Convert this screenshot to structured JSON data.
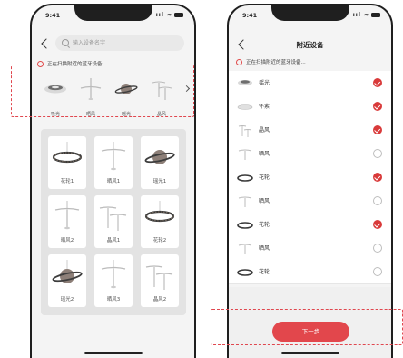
{
  "left_phone": {
    "status": {
      "time": "9:41",
      "indicators": "ııl ≈"
    },
    "search": {
      "placeholder": "输入设备名字"
    },
    "scan_text": "正在扫描附近的蓝牙设备...",
    "strip": [
      {
        "label": "吸光",
        "icon": "ceiling-light-icon"
      },
      {
        "label": "晒风",
        "icon": "fan-light-icon"
      },
      {
        "label": "瑶光",
        "icon": "planet-lamp-icon"
      },
      {
        "label": "晶风",
        "icon": "twin-fan-icon"
      }
    ],
    "grid": [
      {
        "label": "花轮1",
        "icon": "ring-chandelier-icon"
      },
      {
        "label": "晒风1",
        "icon": "fan-light-icon"
      },
      {
        "label": "瑶光1",
        "icon": "planet-lamp-icon"
      },
      {
        "label": "晒风2",
        "icon": "fan-light-icon"
      },
      {
        "label": "晶风1",
        "icon": "twin-fan-icon"
      },
      {
        "label": "花轮2",
        "icon": "ring-chandelier-icon"
      },
      {
        "label": "瑶光2",
        "icon": "planet-lamp-icon"
      },
      {
        "label": "晒风3",
        "icon": "fan-light-icon"
      },
      {
        "label": "晶风2",
        "icon": "twin-fan-icon"
      }
    ]
  },
  "right_phone": {
    "status": {
      "time": "9:41",
      "indicators": "ııl ≈"
    },
    "title": "附近设备",
    "scan_text": "正在扫描附近的蓝牙设备...",
    "devices": [
      {
        "name": "摇光",
        "checked": true,
        "icon": "ceiling-light-icon"
      },
      {
        "name": "怀素",
        "checked": true,
        "icon": "flat-disc-icon"
      },
      {
        "name": "晶风",
        "checked": true,
        "icon": "twin-fan-icon"
      },
      {
        "name": "晒风",
        "checked": false,
        "icon": "fan-light-icon"
      },
      {
        "name": "花轮",
        "checked": true,
        "icon": "ring-chandelier-icon"
      },
      {
        "name": "晒风",
        "checked": false,
        "icon": "fan-light-icon"
      },
      {
        "name": "花轮",
        "checked": true,
        "icon": "ring-chandelier-icon"
      },
      {
        "name": "晒风",
        "checked": false,
        "icon": "fan-light-icon"
      },
      {
        "name": "花轮",
        "checked": false,
        "icon": "ring-chandelier-icon"
      }
    ],
    "next_label": "下一步"
  },
  "colors": {
    "accent": "#e2474c",
    "highlight_dash": "#e0474f"
  }
}
